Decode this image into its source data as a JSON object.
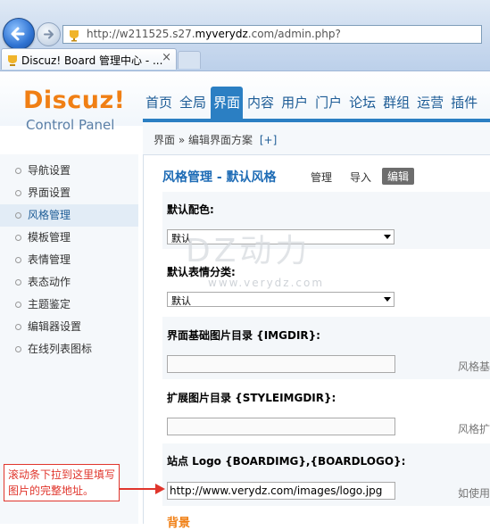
{
  "browser": {
    "address_url_prefix": "http://w211525.s27.",
    "address_url_domain": "myverydz",
    "address_url_suffix": ".com/admin.php?",
    "tab_title": "Discuz! Board 管理中心 - ...",
    "tab_close": "×"
  },
  "header": {
    "logo_text": "Discuz!",
    "logo_sub": "Control Panel",
    "nav": [
      "首页",
      "全局",
      "界面",
      "内容",
      "用户",
      "门户",
      "论坛",
      "群组",
      "运营",
      "插件"
    ],
    "active_nav": "界面"
  },
  "breadcrumb": {
    "section": "界面",
    "sep": "»",
    "page": "编辑界面方案",
    "add": "[+]"
  },
  "sidebar": {
    "items": [
      "导航设置",
      "界面设置",
      "风格管理",
      "模板管理",
      "表情管理",
      "表态动作",
      "主题鉴定",
      "编辑器设置",
      "在线列表图标"
    ],
    "active_item": "风格管理"
  },
  "panel": {
    "title": "风格管理 - 默认风格",
    "tabs": [
      "管理",
      "导入",
      "编辑"
    ],
    "active_tab": "编辑"
  },
  "fields": {
    "default_color_label": "默认配色:",
    "default_color_value": "默认",
    "default_smiley_label": "默认表情分类:",
    "default_smiley_value": "默认",
    "imgdir_label": "界面基础图片目录 {IMGDIR}:",
    "imgdir_value": "",
    "imgdir_hint": "风格基",
    "styleimgdir_label": "扩展图片目录 {STYLEIMGDIR}:",
    "styleimgdir_value": "",
    "styleimgdir_hint": "风格扩",
    "logo_label": "站点 Logo {BOARDIMG},{BOARDLOGO}:",
    "logo_value": "http://www.verydz.com/images/logo.jpg",
    "logo_hint": "如使用",
    "next_label": "背景"
  },
  "watermark": {
    "main": "DZ动力",
    "sub": "www.verydz.com"
  },
  "annotation": {
    "callout_text": "滚动条下拉到这里填写图片的完整地址。",
    "color": "#e0352c"
  },
  "colors": {
    "accent": "#2b7fc3",
    "logo_orange": "#f07f14",
    "link_blue": "#1d5c96"
  }
}
